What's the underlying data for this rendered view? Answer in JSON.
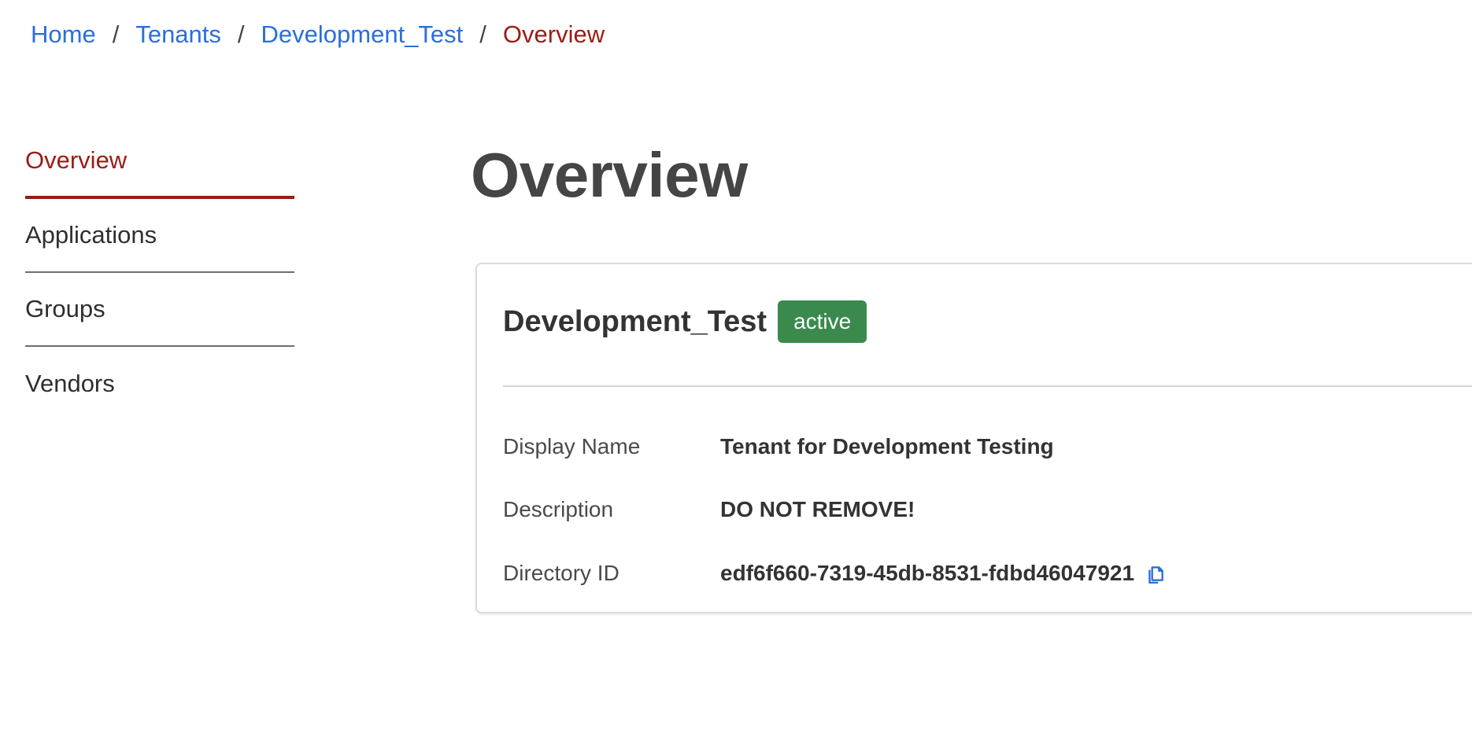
{
  "breadcrumb": {
    "items": [
      {
        "label": "Home"
      },
      {
        "label": "Tenants"
      },
      {
        "label": "Development_Test"
      }
    ],
    "separator": "/",
    "current": "Overview"
  },
  "sidebar": {
    "items": [
      {
        "label": "Overview",
        "active": true
      },
      {
        "label": "Applications"
      },
      {
        "label": "Groups"
      },
      {
        "label": "Vendors"
      }
    ]
  },
  "main": {
    "title": "Overview"
  },
  "tenant": {
    "name": "Development_Test",
    "status": "active",
    "details": [
      {
        "label": "Display Name",
        "value": "Tenant for Development Testing"
      },
      {
        "label": "Description",
        "value": "DO NOT REMOVE!"
      },
      {
        "label": "Directory ID",
        "value": "edf6f660-7319-45db-8531-fdbd46047921",
        "icon": "copy-icon"
      }
    ]
  },
  "colors": {
    "link": "#2a6fdb",
    "accent": "#9b1c14",
    "status_active": "#3a8a4e"
  }
}
